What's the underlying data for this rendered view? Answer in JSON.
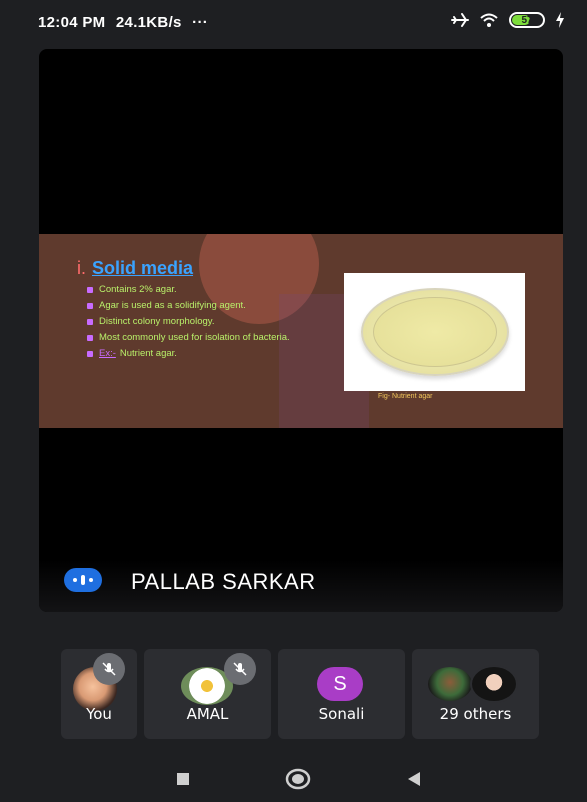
{
  "status": {
    "time": "12:04 PM",
    "speed": "24.1KB/s",
    "dots": "···",
    "battery": "57",
    "icons": [
      "airplane-mode-icon",
      "wifi-icon",
      "battery-icon",
      "charging-icon"
    ]
  },
  "slide": {
    "number": "i.",
    "heading": "Solid media",
    "bullets": [
      "Contains 2% agar.",
      "Agar is used as a solidifying agent.",
      "Distinct colony morphology.",
      "Most commonly used for isolation of bacteria."
    ],
    "example_label": "Ex:-",
    "example_value": "Nutrient agar.",
    "figure_caption": "Fig- Nutrient agar"
  },
  "speaker": {
    "name": "PALLAB SARKAR",
    "icon": "speaking-indicator-icon"
  },
  "participants": [
    {
      "label": "You",
      "muted": true
    },
    {
      "label": "AMAL",
      "muted": true
    },
    {
      "label": "Sonali",
      "initial": "S",
      "muted": false
    },
    {
      "label": "29 others",
      "muted": false
    }
  ],
  "colors": {
    "background": "#1e1f22",
    "tile": "#2c2d31",
    "speaker_badge": "#1f6fe0",
    "sonali_avatar": "#a93dc6",
    "slide_heading": "#3aa3ff",
    "slide_bullet_text": "#b9f06a"
  },
  "nav": [
    "recents-button",
    "home-button",
    "back-button"
  ]
}
